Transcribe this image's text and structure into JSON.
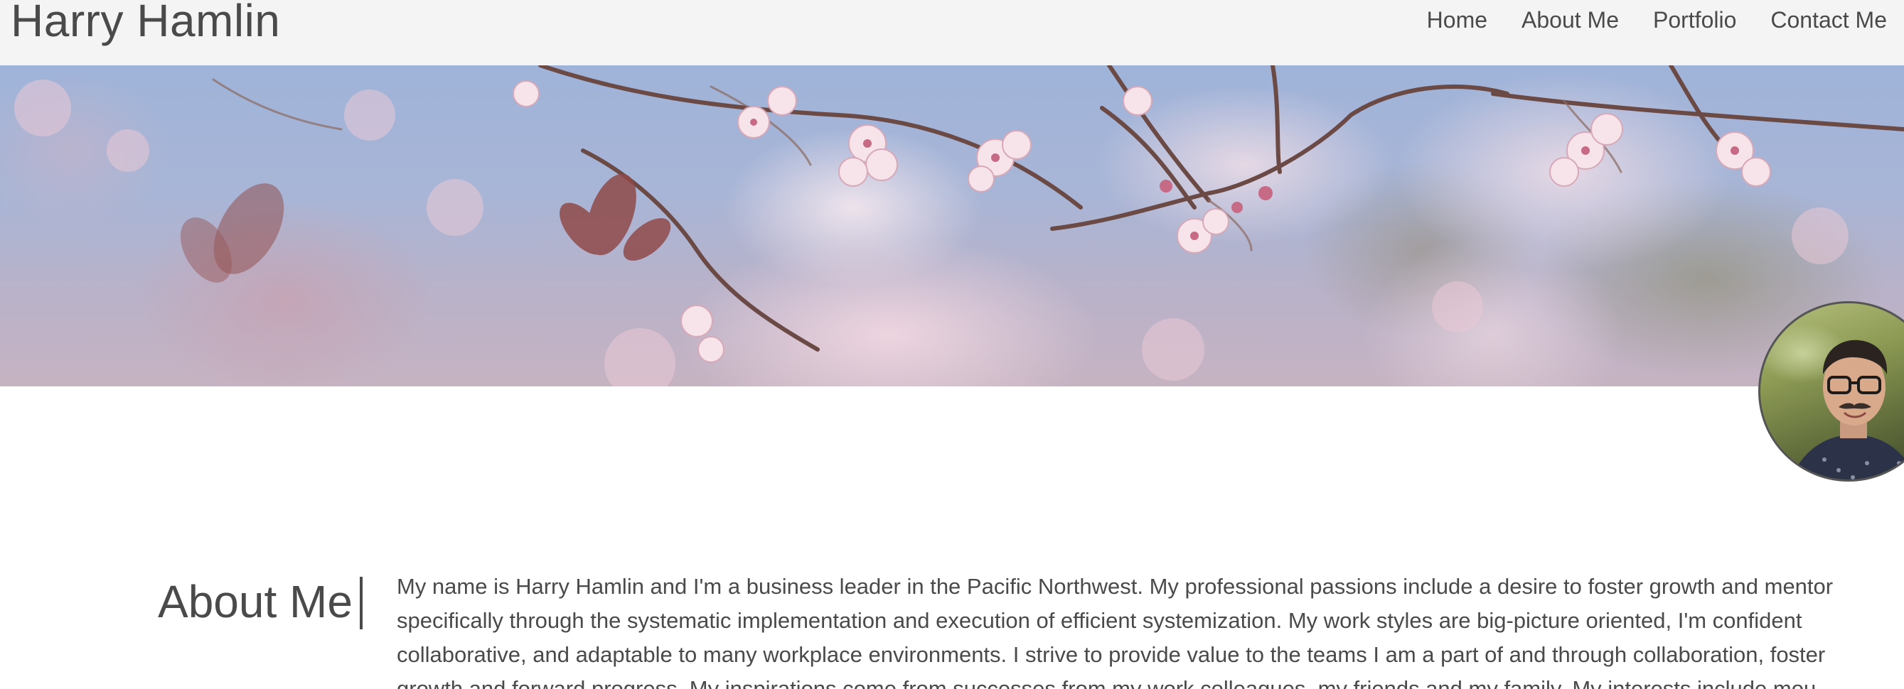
{
  "header": {
    "site_title": "Harry Hamlin",
    "nav": [
      {
        "label": "Home"
      },
      {
        "label": "About Me"
      },
      {
        "label": "Portfolio"
      },
      {
        "label": "Contact Me"
      }
    ]
  },
  "about": {
    "heading": "About Me",
    "lines": [
      "My name is Harry Hamlin and I'm a business leader in the Pacific Northwest. My professional passions include a desire to foster growth and mentor",
      "specifically through the systematic implementation and execution of efficient systemization. My work styles are big-picture oriented, I'm confident",
      "collaborative, and adaptable to many workplace environments. I strive to provide value to the teams I am a part of and through collaboration, foster",
      "growth and forward progress. My inspirations come from successes from my work colleagues, my friends and my family. My interests include mou"
    ]
  },
  "colors": {
    "header_bg": "#f4f4f4",
    "text": "#4a4a4a",
    "banner_sky": "#9fb3d9"
  },
  "icons": {
    "banner": "cherry-blossom-photo",
    "avatar": "profile-photo"
  }
}
